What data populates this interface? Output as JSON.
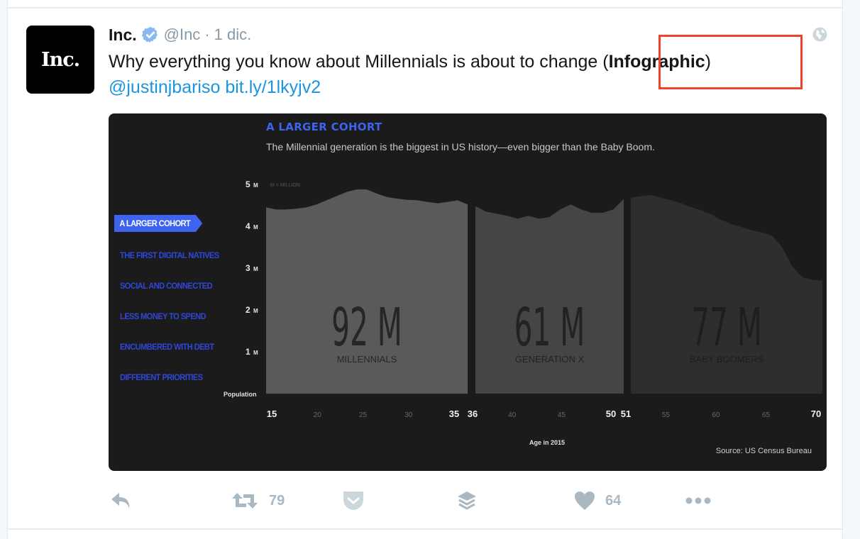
{
  "tweet": {
    "author_name": "Inc.",
    "avatar_text": "Inc.",
    "verified": true,
    "handle": "@Inc",
    "separator": "·",
    "timestamp": "1 dic.",
    "text_before": "Why everything you know about Millennials is about to change (",
    "text_bold": "Infographic",
    "text_after": ")",
    "mention": "@justinjbariso",
    "link": "bit.ly/1lkyjv2",
    "highlight_color": "#f0412b",
    "link_color": "#1b95e0"
  },
  "infographic": {
    "title": "A LARGER COHORT",
    "subtitle": "The Millennial generation is the biggest in US history—even bigger than the Baby Boom.",
    "nav": [
      {
        "label": "A LARGER COHORT",
        "active": true
      },
      {
        "label": "THE FIRST DIGITAL NATIVES",
        "active": false
      },
      {
        "label": "SOCIAL AND CONNECTED",
        "active": false
      },
      {
        "label": "LESS MONEY TO SPEND",
        "active": false
      },
      {
        "label": "ENCUMBERED WITH DEBT",
        "active": false
      },
      {
        "label": "DIFFERENT PRIORITIES",
        "active": false
      }
    ],
    "accent_color": "#3d63f0"
  },
  "chart_data": {
    "type": "area",
    "title": "A LARGER COHORT",
    "subtitle": "The Millennial generation is the biggest in US history—even bigger than the Baby Boom.",
    "xlabel": "Age in 2015",
    "ylabel": "Population",
    "unit_note": "M = MILLION",
    "source": "Source: US Census Bureau",
    "ylim": [
      0,
      5
    ],
    "xlim": [
      15,
      70
    ],
    "y_ticks": [
      {
        "value": 1,
        "label": "1",
        "unit": "M"
      },
      {
        "value": 2,
        "label": "2",
        "unit": "M"
      },
      {
        "value": 3,
        "label": "3",
        "unit": "M"
      },
      {
        "value": 4,
        "label": "4",
        "unit": "M"
      },
      {
        "value": 5,
        "label": "5",
        "unit": "M"
      }
    ],
    "x_ticks": [
      {
        "value": 15,
        "label": "15",
        "major": true
      },
      {
        "value": 20,
        "label": "20",
        "major": false
      },
      {
        "value": 25,
        "label": "25",
        "major": false
      },
      {
        "value": 30,
        "label": "30",
        "major": false
      },
      {
        "value": 35,
        "label": "35",
        "major": true
      },
      {
        "value": 36,
        "label": "36",
        "major": true
      },
      {
        "value": 40,
        "label": "40",
        "major": false
      },
      {
        "value": 45,
        "label": "45",
        "major": false
      },
      {
        "value": 50,
        "label": "50",
        "major": true
      },
      {
        "value": 51,
        "label": "51",
        "major": true
      },
      {
        "value": 55,
        "label": "55",
        "major": false
      },
      {
        "value": 60,
        "label": "60",
        "major": false
      },
      {
        "value": 65,
        "label": "65",
        "major": false
      },
      {
        "value": 70,
        "label": "70",
        "major": true
      }
    ],
    "series": [
      {
        "name": "Millennials",
        "total_label": "92 M",
        "label": "MILLENNIALS",
        "fill": "#5a5a5a",
        "text_color": "#262626",
        "x": [
          15,
          16,
          17,
          18,
          19,
          20,
          21,
          22,
          23,
          24,
          25,
          26,
          27,
          28,
          29,
          30,
          31,
          32,
          33,
          34,
          35
        ],
        "values": [
          4.45,
          4.4,
          4.4,
          4.42,
          4.45,
          4.52,
          4.62,
          4.72,
          4.82,
          4.88,
          4.88,
          4.78,
          4.7,
          4.66,
          4.63,
          4.62,
          4.58,
          4.55,
          4.58,
          4.62,
          4.52
        ]
      },
      {
        "name": "Generation X",
        "total_label": "61 M",
        "label": "GENERATION X",
        "fill": "#454545",
        "text_color": "#222222",
        "x": [
          36,
          37,
          38,
          39,
          40,
          41,
          42,
          43,
          44,
          45,
          46,
          47,
          48,
          49,
          50
        ],
        "values": [
          4.48,
          4.35,
          4.3,
          4.25,
          4.18,
          4.25,
          4.18,
          4.22,
          4.4,
          4.52,
          4.4,
          4.32,
          4.32,
          4.4,
          4.65
        ]
      },
      {
        "name": "Baby Boomers",
        "total_label": "77 M",
        "label": "BABY BOOMERS",
        "fill": "#2e2e2e",
        "text_color": "#1e1e1e",
        "x": [
          51,
          52,
          53,
          54,
          55,
          56,
          57,
          58,
          59,
          60,
          61,
          62,
          63,
          64,
          65,
          66,
          67,
          68,
          69,
          70
        ],
        "values": [
          4.68,
          4.72,
          4.75,
          4.68,
          4.62,
          4.55,
          4.45,
          4.38,
          4.28,
          4.15,
          4.05,
          3.98,
          3.9,
          3.85,
          3.78,
          3.5,
          3.05,
          2.78,
          2.72,
          2.7
        ]
      }
    ]
  },
  "actions": {
    "reply_label": "",
    "retweet_count": "79",
    "like_count": "64",
    "icon_color": "#aab8c2"
  }
}
